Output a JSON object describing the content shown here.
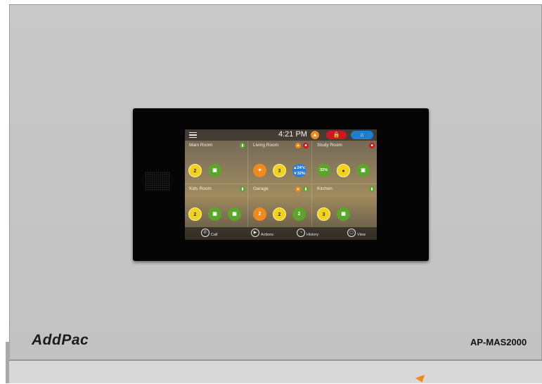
{
  "brand": {
    "logo_text": "AddPac",
    "model": "AP-MAS2000"
  },
  "screen": {
    "status": {
      "time": "4:21 PM",
      "alert_glyph": "▲",
      "lock_glyph": "🔒",
      "home_glyph": "⌂"
    },
    "rooms": [
      {
        "name": "Main Room",
        "devices": [
          "2",
          "▣"
        ]
      },
      {
        "name": "Living Room",
        "devices": [
          "✦",
          "3",
          "▲24°c\n▼32%"
        ]
      },
      {
        "name": "Study Room",
        "devices": [
          "32%",
          "●",
          "▣"
        ]
      },
      {
        "name": "Kids Room",
        "devices": [
          "2",
          "▣",
          "▣"
        ]
      },
      {
        "name": "Garage",
        "devices": [
          "2",
          "2",
          "2"
        ]
      },
      {
        "name": "Kitchen",
        "devices": [
          "3",
          "▣"
        ]
      }
    ],
    "nav": {
      "call": "Call",
      "actions": "Actions",
      "history": "History",
      "view": "View"
    },
    "icons": [
      "menu-icon",
      "alert-icon",
      "lock-icon",
      "home-icon",
      "phone-icon",
      "play-icon",
      "clock-icon",
      "view-icon"
    ]
  },
  "colors": {
    "accent_red": "#d0161e",
    "accent_blue": "#1d7fd0",
    "accent_orange": "#f08a1c",
    "accent_green": "#5aa830"
  }
}
